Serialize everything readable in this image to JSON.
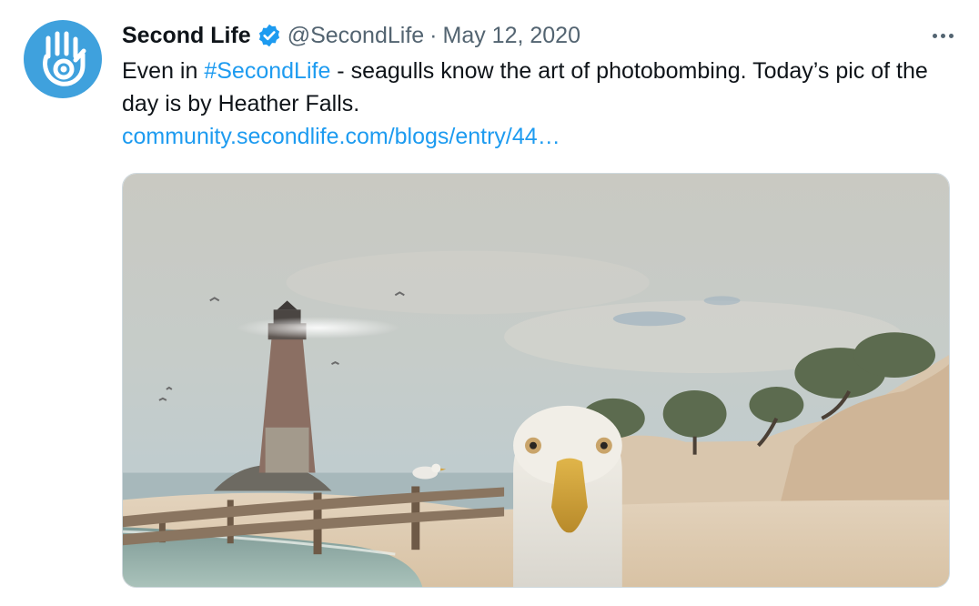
{
  "tweet": {
    "author_name": "Second Life",
    "verified": true,
    "handle": "@SecondLife",
    "separator": "·",
    "date": "May 12, 2020",
    "text_before": "Even in ",
    "hashtag": "#SecondLife",
    "text_after": " - seagulls know the art of photobombing. Today’s pic of the day is by Heather Falls.",
    "link": "community.secondlife.com/blogs/entry/44…",
    "more_icon": "more-horizontal-icon",
    "avatar_icon": "second-life-hand-eye-logo",
    "accent_color": "#1d9bf0",
    "avatar_color": "#3fa1dd"
  },
  "media": {
    "alt": "Seagull photobombing in front of a lighthouse on a beach"
  }
}
